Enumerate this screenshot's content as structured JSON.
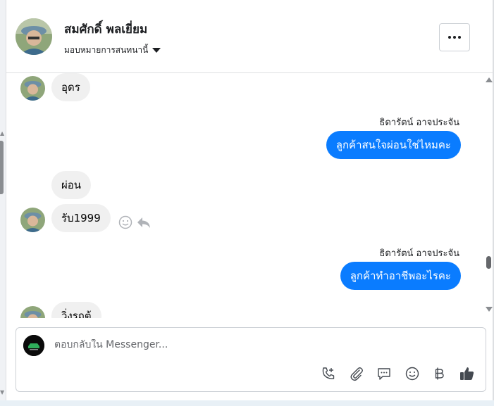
{
  "header": {
    "contact_name": "สมศักดิ์ พลเยี่ยม",
    "assign_label": "มอบหมายการสนทนานี้",
    "more_label": "More options"
  },
  "messages": [
    {
      "direction": "in",
      "text": "อุดร"
    },
    {
      "direction": "out",
      "sender": "ธิดารัตน์ อาจประจัน",
      "text": "ลูกค้าสนใจผ่อนใช่ไหมคะ"
    },
    {
      "direction": "in",
      "text": "ผ่อน"
    },
    {
      "direction": "in",
      "text": "รับ1999"
    },
    {
      "direction": "out",
      "sender": "ธิดารัตน์ อาจประจัน",
      "text": "ลูกค้าทำอาชีพอะไรคะ"
    },
    {
      "direction": "in",
      "text": "วิ่งรถตู้"
    }
  ],
  "composer": {
    "placeholder": "ตอบกลับใน Messenger...",
    "value": "",
    "tools": [
      "call-add-icon",
      "attachment-icon",
      "saved-reply-icon",
      "emoji-icon",
      "baht-icon",
      "like-icon"
    ]
  },
  "colors": {
    "outgoing_bubble": "#0a7cff",
    "incoming_bubble": "#f0f0f0"
  }
}
